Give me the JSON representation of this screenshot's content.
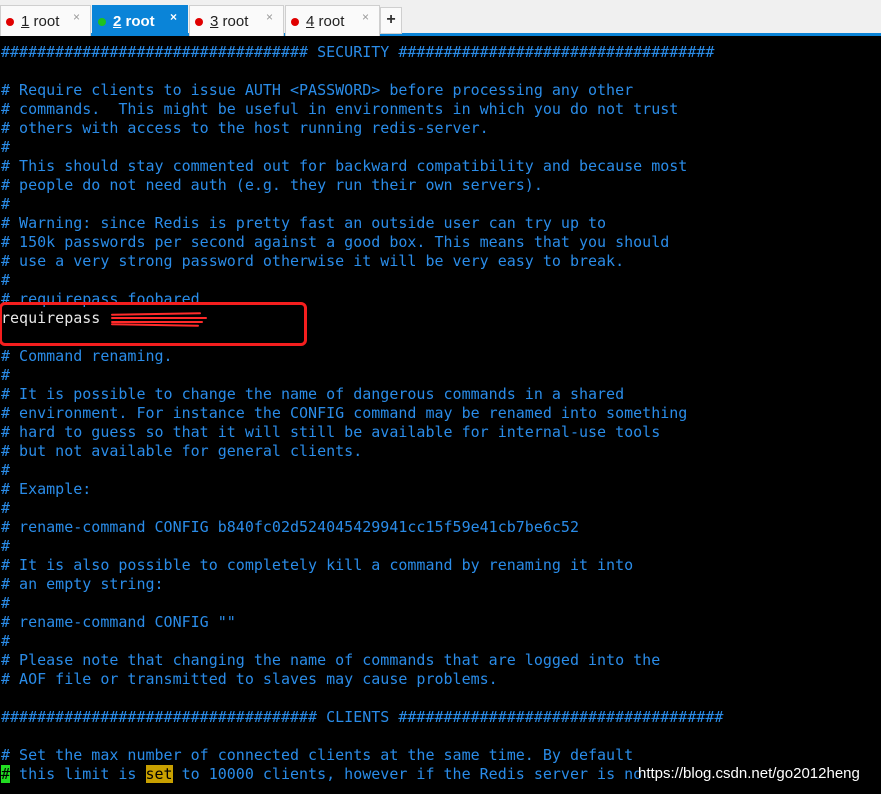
{
  "tabs": [
    {
      "num": "1",
      "label": " root",
      "active": false,
      "status_color": "#e00000"
    },
    {
      "num": "2",
      "label": " root",
      "active": true,
      "status_color": "#1fc21f"
    },
    {
      "num": "3",
      "label": " root",
      "active": false,
      "status_color": "#e00000"
    },
    {
      "num": "4",
      "label": " root",
      "active": false,
      "status_color": "#e00000"
    }
  ],
  "tab_close": "×",
  "new_tab": "+",
  "terminal": {
    "lines": [
      "################################## SECURITY ###################################",
      "",
      "# Require clients to issue AUTH <PASSWORD> before processing any other",
      "# commands.  This might be useful in environments in which you do not trust",
      "# others with access to the host running redis-server.",
      "#",
      "# This should stay commented out for backward compatibility and because most",
      "# people do not need auth (e.g. they run their own servers).",
      "#",
      "# Warning: since Redis is pretty fast an outside user can try up to",
      "# 150k passwords per second against a good box. This means that you should",
      "# use a very strong password otherwise it will be very easy to break.",
      "#",
      "# requirepass foobared",
      "requirepass ",
      "",
      "# Command renaming.",
      "#",
      "# It is possible to change the name of dangerous commands in a shared",
      "# environment. For instance the CONFIG command may be renamed into something",
      "# hard to guess so that it will still be available for internal-use tools",
      "# but not available for general clients.",
      "#",
      "# Example:",
      "#",
      "# rename-command CONFIG b840fc02d524045429941cc15f59e41cb7be6c52",
      "#",
      "# It is also possible to completely kill a command by renaming it into",
      "# an empty string:",
      "#",
      "# rename-command CONFIG \"\"",
      "#",
      "# Please note that changing the name of commands that are logged into the",
      "# AOF file or transmitted to slaves may cause problems.",
      "",
      "################################### CLIENTS ####################################",
      "",
      "# Set the max number of connected clients at the same time. By default"
    ],
    "last_line": {
      "cursor": "#",
      "before": " this limit is ",
      "highlight": "set",
      "after": " to 10000 clients, however if the Redis server is no"
    },
    "text_color": "#2a8ce8",
    "highlight_color": "#c8a000",
    "cursor_color": "#22dd22"
  },
  "watermark": "https://blog.csdn.net/go2012heng"
}
